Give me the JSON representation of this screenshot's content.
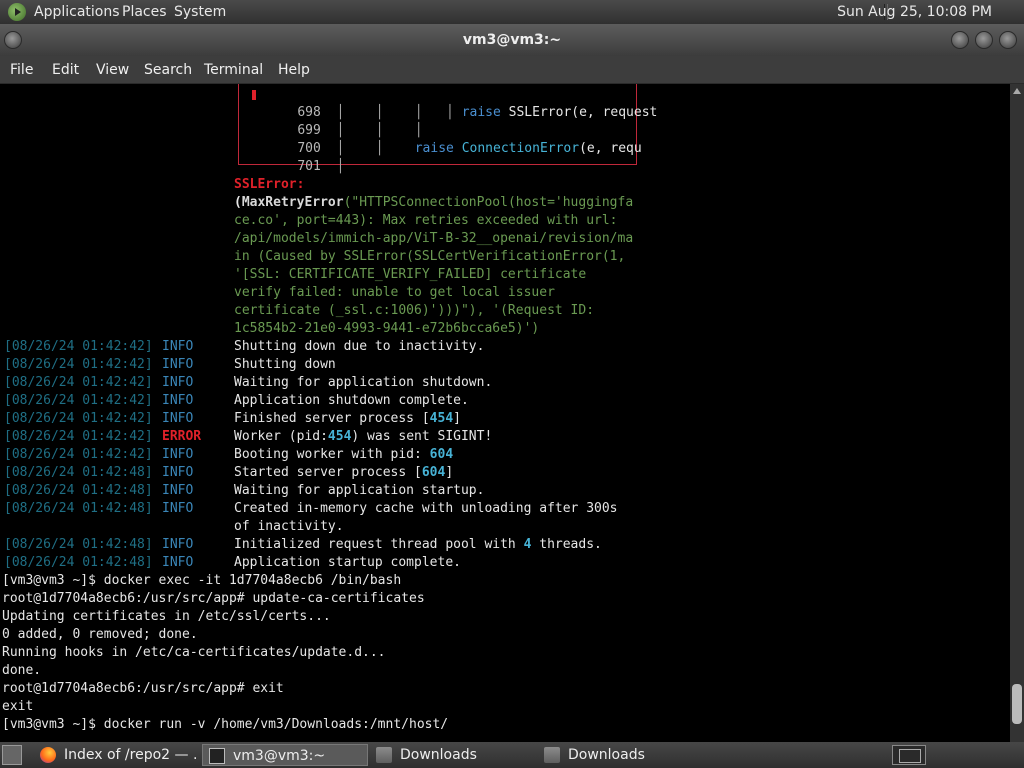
{
  "top_panel": {
    "menus": [
      "Applications",
      "Places",
      "System"
    ],
    "clock": "Sun Aug 25, 10:08 PM"
  },
  "window": {
    "title": "vm3@vm3:~",
    "menu": [
      "File",
      "Edit",
      "View",
      "Search",
      "Terminal",
      "Help"
    ]
  },
  "terminal": {
    "traceback_lines": [
      {
        "num": "698",
        "code": "raise SSLError(e, request"
      },
      {
        "num": "699",
        "code": ""
      },
      {
        "num": "700",
        "code": "raise ConnectionError(e, requ"
      },
      {
        "num": "701",
        "code": ""
      }
    ],
    "error_block": {
      "name": "SSLError:",
      "line1_open": "(",
      "line1_cls": "MaxRetryError",
      "line1_rest": "(\"HTTPSConnectionPool(host='huggingfa",
      "lines": [
        "ce.co', port=443): Max retries exceeded with url:",
        "/api/models/immich-app/ViT-B-32__openai/revision/ma",
        "in (Caused by SSLError(SSLCertVerificationError(1,",
        "'[SSL: CERTIFICATE_VERIFY_FAILED] certificate",
        "verify failed: unable to get local issuer",
        "certificate (_ssl.c:1006)')))\"), '(Request ID:",
        "1c5854b2-21e0-4993-9441-e72b6bcca6e5)')"
      ]
    },
    "logs": [
      {
        "ts": "[08/26/24 01:42:42]",
        "level": "INFO",
        "msg": "Shutting down due to inactivity."
      },
      {
        "ts": "[08/26/24 01:42:42]",
        "level": "INFO",
        "msg": "Shutting down"
      },
      {
        "ts": "[08/26/24 01:42:42]",
        "level": "INFO",
        "msg": "Waiting for application shutdown."
      },
      {
        "ts": "[08/26/24 01:42:42]",
        "level": "INFO",
        "msg": "Application shutdown complete."
      },
      {
        "ts": "[08/26/24 01:42:42]",
        "level": "INFO",
        "msg": "Finished server process [",
        "hl": "454",
        "after": "]"
      },
      {
        "ts": "[08/26/24 01:42:42]",
        "level": "ERROR",
        "msg": "Worker (pid:",
        "hl": "454",
        "after": ") was sent SIGINT!"
      },
      {
        "ts": "[08/26/24 01:42:42]",
        "level": "INFO",
        "msg": "Booting worker with pid: ",
        "hl": "604",
        "after": ""
      },
      {
        "ts": "[08/26/24 01:42:48]",
        "level": "INFO",
        "msg": "Started server process [",
        "hl": "604",
        "after": "]"
      },
      {
        "ts": "[08/26/24 01:42:48]",
        "level": "INFO",
        "msg": "Waiting for application startup."
      },
      {
        "ts": "[08/26/24 01:42:48]",
        "level": "INFO",
        "msg": "Created in-memory cache with unloading after 300s"
      },
      {
        "ts": "",
        "level": "",
        "msg": "of inactivity."
      },
      {
        "ts": "[08/26/24 01:42:48]",
        "level": "INFO",
        "msg": "Initialized request thread pool with ",
        "hl": "4",
        "after": " threads."
      },
      {
        "ts": "[08/26/24 01:42:48]",
        "level": "INFO",
        "msg": "Application startup complete."
      }
    ],
    "shell": [
      "[vm3@vm3 ~]$ docker exec -it 1d7704a8ecb6 /bin/bash",
      "root@1d7704a8ecb6:/usr/src/app# update-ca-certificates",
      "Updating certificates in /etc/ssl/certs...",
      "0 added, 0 removed; done.",
      "Running hooks in /etc/ca-certificates/update.d...",
      "done.",
      "root@1d7704a8ecb6:/usr/src/app# exit",
      "exit",
      "[vm3@vm3 ~]$ docker run -v /home/vm3/Downloads:/mnt/host/"
    ]
  },
  "taskbar": {
    "tasks": [
      {
        "label": "Index of /repo2 — ...",
        "icon": "firefox-icon"
      },
      {
        "label": "vm3@vm3:~",
        "icon": "terminal-icon",
        "active": true
      },
      {
        "label": "Downloads",
        "icon": "folder-icon"
      },
      {
        "label": "Downloads",
        "icon": "folder-icon"
      }
    ]
  }
}
